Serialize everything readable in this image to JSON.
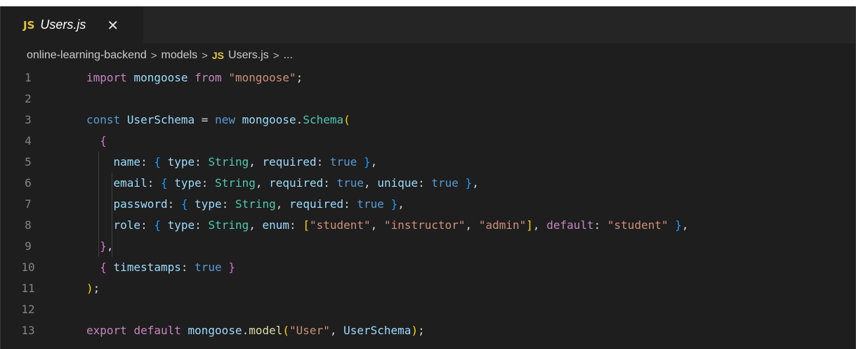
{
  "tab": {
    "icon_label": "JS",
    "title": "Users.js",
    "close_glyph": "✕"
  },
  "breadcrumb": {
    "items": [
      "online-learning-backend",
      "models",
      "Users.js",
      "..."
    ],
    "file_icon_label": "JS",
    "separator": ">"
  },
  "colors": {
    "editor_bg": "#1e1e1e",
    "js_icon": "#e2c541",
    "keyword": "#c586c0",
    "type_keyword": "#569cd6",
    "string": "#ce9178",
    "variable": "#9cdcfe",
    "class": "#4ec9b0",
    "function": "#dcdcaa"
  },
  "code_lines": [
    {
      "number": "1",
      "text": "import mongoose from \"mongoose\";"
    },
    {
      "number": "2",
      "text": ""
    },
    {
      "number": "3",
      "text": "const UserSchema = new mongoose.Schema("
    },
    {
      "number": "4",
      "text": "  {"
    },
    {
      "number": "5",
      "text": "    name: { type: String, required: true },"
    },
    {
      "number": "6",
      "text": "    email: { type: String, required: true, unique: true },"
    },
    {
      "number": "7",
      "text": "    password: { type: String, required: true },"
    },
    {
      "number": "8",
      "text": "    role: { type: String, enum: [\"student\", \"instructor\", \"admin\"], default: \"student\" },"
    },
    {
      "number": "9",
      "text": "  },"
    },
    {
      "number": "10",
      "text": "  { timestamps: true }"
    },
    {
      "number": "11",
      "text": ");"
    },
    {
      "number": "12",
      "text": ""
    },
    {
      "number": "13",
      "text": "export default mongoose.model(\"User\", UserSchema);"
    }
  ]
}
